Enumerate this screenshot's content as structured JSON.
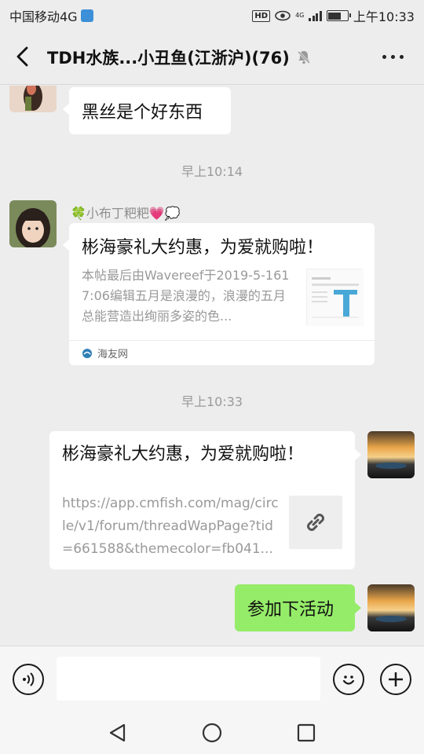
{
  "status_bar": {
    "carrier": "中国移动4G",
    "hd_badge": "HD",
    "network_badge": "4G",
    "time": "上午10:33",
    "battery_level": 0.7
  },
  "header": {
    "title": "TDH水族...小丑鱼(江浙沪)(76)",
    "muted_icon": "bell-muted-icon"
  },
  "messages": {
    "m1": {
      "text": "黑丝是个好东西"
    },
    "time1": "早上10:14",
    "m2": {
      "sender": "🍀小布丁粑粑💗💭",
      "card_title": "彬海豪礼大约惠，为爱就购啦！",
      "card_desc": "本帖最后由Wavereef于2019-5-1617:06编辑五月是浪漫的，浪漫的五月总能营造出绚丽多姿的色...",
      "source": "海友网"
    },
    "time2": "早上10:33",
    "m3": {
      "card_title": "彬海豪礼大约惠，为爱就购啦！",
      "card_url": "https://app.cmfish.com/mag/circle/v1/forum/threadWapPage?tid=661588&themecolor=fb041..."
    },
    "m4": {
      "text": "参加下活动"
    }
  },
  "colors": {
    "background": "#ededed",
    "my_bubble": "#95ec69",
    "other_bubble": "#ffffff"
  }
}
